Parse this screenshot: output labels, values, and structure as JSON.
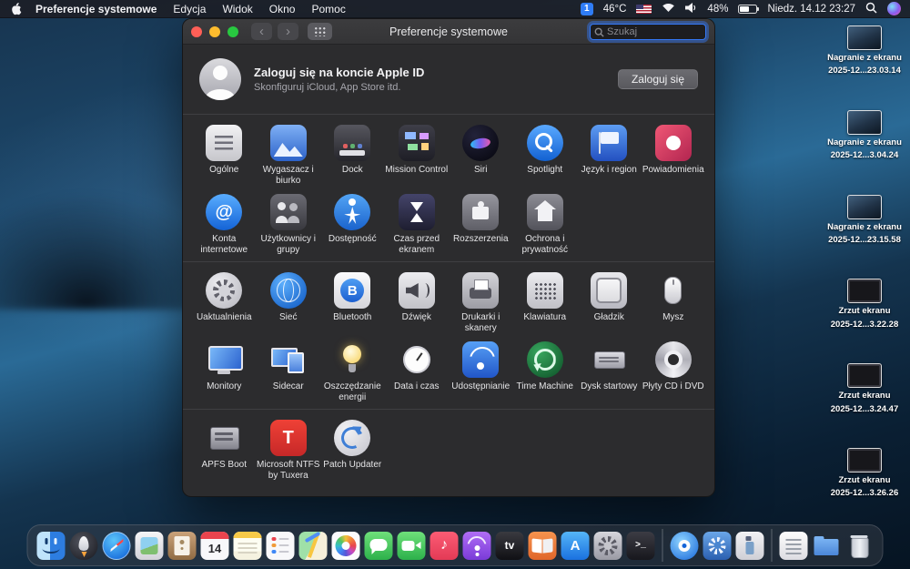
{
  "menubar": {
    "app_menu": "Preferencje systemowe",
    "menus": [
      {
        "id": "edycja",
        "label": "Edycja"
      },
      {
        "id": "widok",
        "label": "Widok"
      },
      {
        "id": "okno",
        "label": "Okno"
      },
      {
        "id": "pomoc",
        "label": "Pomoc"
      }
    ],
    "status": {
      "badge": "1",
      "temp": "46°C",
      "battery": "48%",
      "clock": "Niedz. 14.12 23:27"
    }
  },
  "window": {
    "title": "Preferencje systemowe",
    "search": {
      "placeholder": "Szukaj"
    },
    "apple_id": {
      "title": "Zaloguj się na koncie Apple ID",
      "subtitle": "Skonfiguruj iCloud, App Store itd.",
      "button": "Zaloguj się"
    },
    "sections": [
      {
        "items": [
          {
            "id": "general",
            "label": "Ogólne"
          },
          {
            "id": "desktop-screensaver",
            "label": "Wygaszacz i biurko"
          },
          {
            "id": "dock",
            "label": "Dock"
          },
          {
            "id": "mission-control",
            "label": "Mission Control"
          },
          {
            "id": "siri",
            "label": "Siri"
          },
          {
            "id": "spotlight",
            "label": "Spotlight"
          },
          {
            "id": "language-region",
            "label": "Język i region"
          },
          {
            "id": "notifications",
            "label": "Powiadomienia"
          },
          {
            "id": "internet-accounts",
            "label": "Konta internetowe",
            "glyph": "@"
          },
          {
            "id": "users-groups",
            "label": "Użytkownicy i grupy"
          },
          {
            "id": "accessibility",
            "label": "Dostępność"
          },
          {
            "id": "screen-time",
            "label": "Czas przed ekranem"
          },
          {
            "id": "extensions",
            "label": "Rozszerzenia"
          },
          {
            "id": "security-privacy",
            "label": "Ochrona i prywatność"
          }
        ]
      },
      {
        "items": [
          {
            "id": "software-update",
            "label": "Uaktualnienia"
          },
          {
            "id": "network",
            "label": "Sieć"
          },
          {
            "id": "bluetooth",
            "label": "Bluetooth",
            "glyph": "B"
          },
          {
            "id": "sound",
            "label": "Dźwięk"
          },
          {
            "id": "printers-scanners",
            "label": "Drukarki i skanery"
          },
          {
            "id": "keyboard",
            "label": "Klawiatura"
          },
          {
            "id": "trackpad",
            "label": "Gładzik"
          },
          {
            "id": "mouse",
            "label": "Mysz"
          },
          {
            "id": "displays",
            "label": "Monitory"
          },
          {
            "id": "sidecar",
            "label": "Sidecar"
          },
          {
            "id": "energy-saver",
            "label": "Oszczędzanie energii"
          },
          {
            "id": "date-time",
            "label": "Data i czas"
          },
          {
            "id": "sharing",
            "label": "Udostępnianie"
          },
          {
            "id": "time-machine",
            "label": "Time Machine"
          },
          {
            "id": "startup-disk",
            "label": "Dysk startowy"
          },
          {
            "id": "cd-dvd",
            "label": "Płyty CD i DVD"
          }
        ]
      },
      {
        "items": [
          {
            "id": "apfs-boot",
            "label": "APFS Boot"
          },
          {
            "id": "ms-ntfs",
            "label": "Microsoft NTFS by Tuxera",
            "glyph": "T"
          },
          {
            "id": "patch-updater",
            "label": "Patch Updater"
          }
        ]
      }
    ]
  },
  "desktop": {
    "files": [
      {
        "type": "recording",
        "line1": "Nagranie z ekranu",
        "line2": "2025-12...23.03.14"
      },
      {
        "type": "recording",
        "line1": "Nagranie z ekranu",
        "line2": "2025-12...3.04.24"
      },
      {
        "type": "recording",
        "line1": "Nagranie z ekranu",
        "line2": "2025-12...23.15.58"
      },
      {
        "type": "screenshot",
        "line1": "Zrzut ekranu",
        "line2": "2025-12...3.22.28"
      },
      {
        "type": "screenshot",
        "line1": "Zrzut ekranu",
        "line2": "2025-12...3.24.47"
      },
      {
        "type": "screenshot",
        "line1": "Zrzut ekranu",
        "line2": "2025-12...3.26.26"
      }
    ]
  },
  "dock": {
    "items": [
      {
        "id": "finder"
      },
      {
        "id": "launchpad"
      },
      {
        "id": "safari"
      },
      {
        "id": "preview"
      },
      {
        "id": "contacts"
      },
      {
        "id": "calendar",
        "text": "14"
      },
      {
        "id": "notes"
      },
      {
        "id": "reminders"
      },
      {
        "id": "maps"
      },
      {
        "id": "photos"
      },
      {
        "id": "messages"
      },
      {
        "id": "facetime"
      },
      {
        "id": "music",
        "text": "♪"
      },
      {
        "id": "podcasts"
      },
      {
        "id": "tv",
        "text": "tv"
      },
      {
        "id": "books"
      },
      {
        "id": "appstore",
        "text": "A"
      },
      {
        "id": "sysprefs"
      },
      {
        "id": "terminal",
        "text": ">_"
      },
      {
        "type": "separator"
      },
      {
        "id": "browser"
      },
      {
        "id": "gears"
      },
      {
        "id": "cleaner"
      },
      {
        "type": "separator"
      },
      {
        "id": "documents"
      },
      {
        "id": "downloads"
      },
      {
        "id": "trash"
      }
    ]
  },
  "colors": {
    "accent": "#3478f6"
  }
}
